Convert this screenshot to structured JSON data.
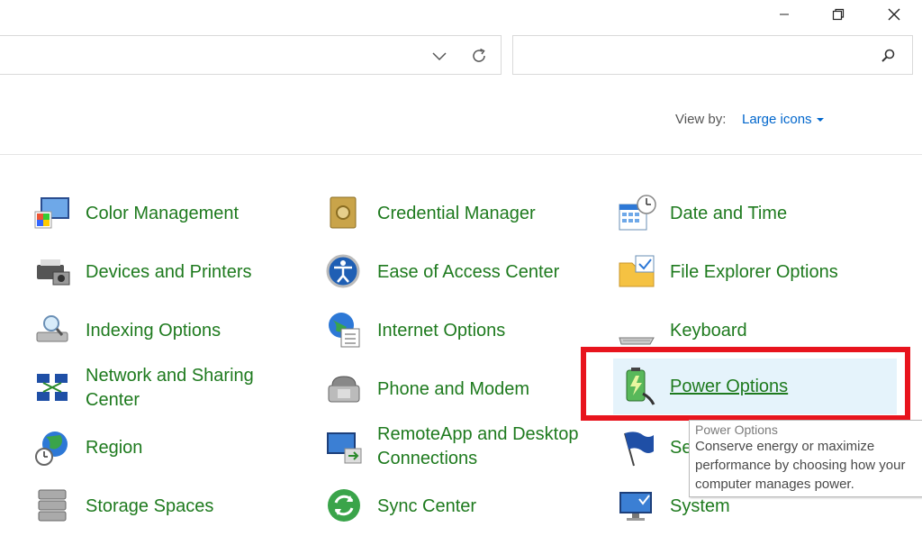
{
  "window": {
    "minimize_icon": "minimize-icon",
    "restore_icon": "restore-icon",
    "close_icon": "close-icon"
  },
  "address": {
    "value": "",
    "dropdown_icon": "chevron-down-icon",
    "refresh_icon": "refresh-icon"
  },
  "search": {
    "placeholder": "",
    "icon": "search-icon"
  },
  "view": {
    "label": "View by:",
    "value": "Large icons"
  },
  "items": [
    {
      "label": "Color Management",
      "icon": "color-management-icon"
    },
    {
      "label": "Credential Manager",
      "icon": "credential-manager-icon"
    },
    {
      "label": "Date and Time",
      "icon": "date-time-icon"
    },
    {
      "label": "Devices and Printers",
      "icon": "devices-printers-icon"
    },
    {
      "label": "Ease of Access Center",
      "icon": "ease-of-access-icon"
    },
    {
      "label": "File Explorer Options",
      "icon": "folder-options-icon"
    },
    {
      "label": "Indexing Options",
      "icon": "indexing-options-icon"
    },
    {
      "label": "Internet Options",
      "icon": "internet-options-icon"
    },
    {
      "label": "Keyboard",
      "icon": "keyboard-icon"
    },
    {
      "label_line1": "Network and Sharing",
      "label_line2": "Center",
      "icon": "network-sharing-icon"
    },
    {
      "label": "Phone and Modem",
      "icon": "phone-modem-icon"
    },
    {
      "label": "Power Options",
      "icon": "power-options-icon"
    },
    {
      "label": "Region",
      "icon": "region-icon"
    },
    {
      "label_line1": "RemoteApp and Desktop",
      "label_line2": "Connections",
      "icon": "remoteapp-icon"
    },
    {
      "label": "Se",
      "icon": "security-flag-icon"
    },
    {
      "label": "Storage Spaces",
      "icon": "storage-spaces-icon"
    },
    {
      "label": "Sync Center",
      "icon": "sync-center-icon"
    },
    {
      "label": "System",
      "icon": "system-icon"
    }
  ],
  "tooltip": {
    "title": "Power Options",
    "line1": "Conserve energy or maximize",
    "line2": "performance by choosing how your",
    "line3": "computer manages power."
  },
  "colors": {
    "link_green": "#1e7a1e",
    "accent_blue": "#0066cc",
    "highlight_red": "#e8141d",
    "hover_bg": "#e5f3fb"
  }
}
